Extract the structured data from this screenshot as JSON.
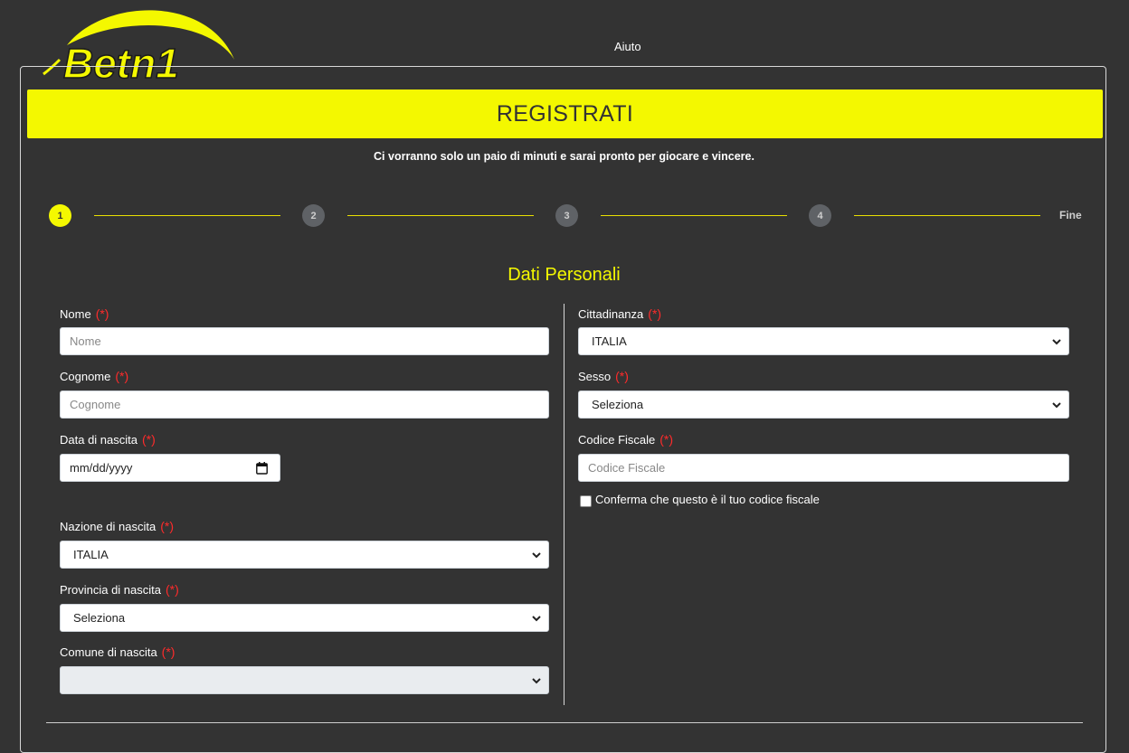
{
  "header": {
    "logo_text": "Betn1",
    "help_label": "Aiuto"
  },
  "registration": {
    "title": "REGISTRATI",
    "subtitle": "Ci vorranno solo un paio di minuti e sarai pronto per giocare e vincere.",
    "steps": [
      "1",
      "2",
      "3",
      "4"
    ],
    "final_step_label": "Fine",
    "active_step": 1,
    "section_title": "Dati Personali"
  },
  "form": {
    "required_marker": "(*)",
    "nome": {
      "label": "Nome",
      "placeholder": "Nome"
    },
    "cognome": {
      "label": "Cognome",
      "placeholder": "Cognome"
    },
    "data_nascita": {
      "label": "Data di nascita",
      "placeholder": "mm/dd/yyyy"
    },
    "nazione_nascita": {
      "label": "Nazione di nascita",
      "value": "ITALIA"
    },
    "provincia_nascita": {
      "label": "Provincia di nascita",
      "value": "Seleziona"
    },
    "comune_nascita": {
      "label": "Comune di nascita",
      "value": ""
    },
    "cittadinanza": {
      "label": "Cittadinanza",
      "value": "ITALIA"
    },
    "sesso": {
      "label": "Sesso",
      "value": "Seleziona"
    },
    "codice_fiscale": {
      "label": "Codice Fiscale",
      "placeholder": "Codice Fiscale"
    },
    "conferma_cf": {
      "label": "Conferma che questo è il tuo codice fiscale",
      "checked": false
    }
  },
  "colors": {
    "background": "#333333",
    "accent": "#f4f800",
    "required": "#ff2b2b"
  }
}
